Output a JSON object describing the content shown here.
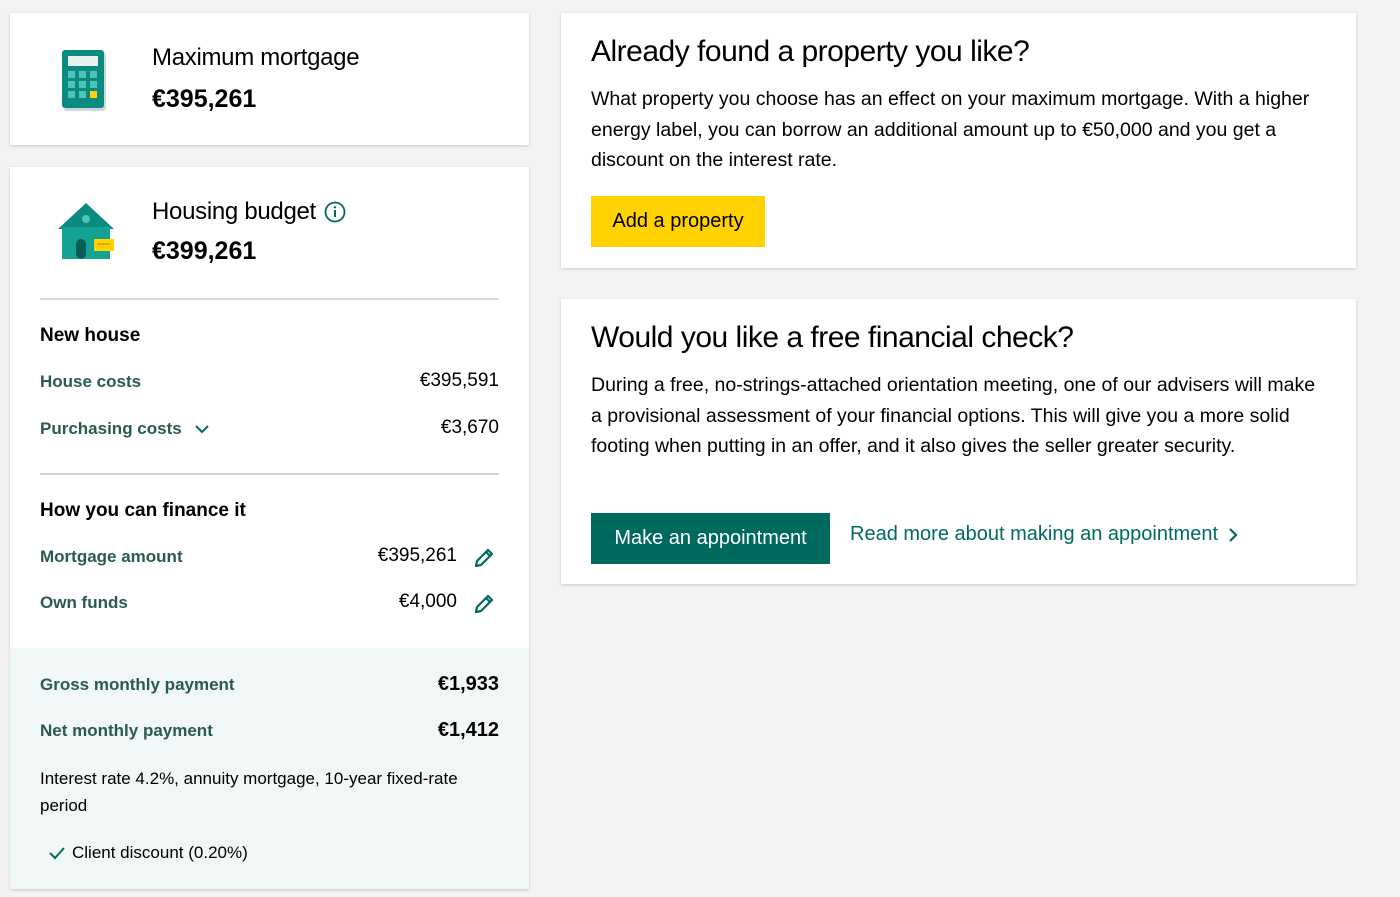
{
  "max_mortgage": {
    "title": "Maximum mortgage",
    "amount": "€395,261"
  },
  "housing_budget": {
    "title": "Housing budget",
    "amount": "€399,261",
    "new_house": {
      "heading": "New house",
      "rows": [
        {
          "label": "House costs",
          "value": "€395,591"
        },
        {
          "label": "Purchasing costs",
          "value": "€3,670"
        }
      ]
    },
    "finance": {
      "heading": "How you can finance it",
      "rows": [
        {
          "label": "Mortgage amount",
          "value": "€395,261"
        },
        {
          "label": "Own funds",
          "value": "€4,000"
        }
      ]
    },
    "summary": {
      "gross_label": "Gross monthly payment",
      "gross_value": "€1,933",
      "net_label": "Net monthly payment",
      "net_value": "€1,412",
      "note": "Interest rate 4.2%, annuity mortgage, 10-year fixed-rate period",
      "discount": "Client discount (0.20%)"
    }
  },
  "property_card": {
    "title": "Already found a property you like?",
    "body": "What property you choose has an effect on your maximum mortgage. With a higher energy label, you can borrow an additional amount up to €50,000 and you get a discount on the interest rate.",
    "button": "Add a property"
  },
  "check_card": {
    "title": "Would you like a free financial check?",
    "body": "During a free, no-strings-attached orientation meeting, one of our advisers will make a provisional assessment of your financial options. This will give you a more solid footing when putting in an offer, and it also gives the seller greater security.",
    "button": "Make an appointment",
    "link": "Read more about making an appointment"
  },
  "colors": {
    "teal": "#006a5f",
    "yellow": "#ffd200",
    "label_green": "#2a5a52",
    "summary_bg": "#f1f6f6"
  },
  "icons": [
    "calculator-icon",
    "house-icon",
    "info-icon",
    "chevron-down-icon",
    "pencil-icon",
    "checkmark-icon",
    "chevron-right-icon"
  ]
}
